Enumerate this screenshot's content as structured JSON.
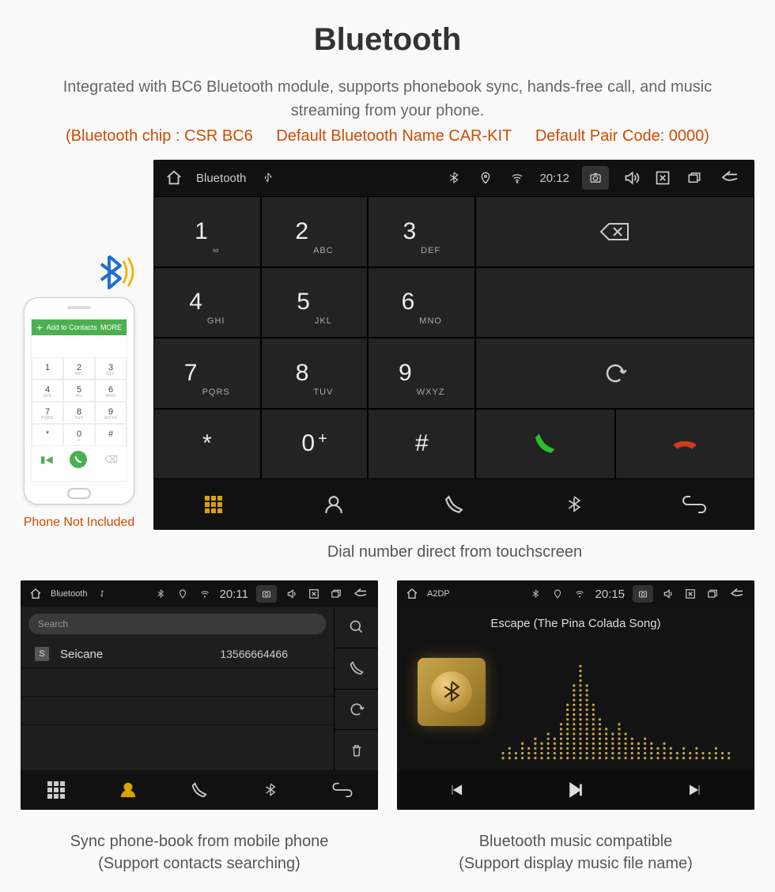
{
  "title": "Bluetooth",
  "description": "Integrated with BC6 Bluetooth module, supports phonebook sync, hands-free call, and music streaming from your phone.",
  "spec": {
    "chip": "(Bluetooth chip : CSR BC6",
    "name": "Default Bluetooth Name CAR-KIT",
    "code": "Default Pair Code: 0000)"
  },
  "phone_mock": {
    "bar_label": "Add to Contacts",
    "bar_more": "MORE",
    "keys": [
      {
        "n": "1",
        "s": ""
      },
      {
        "n": "2",
        "s": "ABC"
      },
      {
        "n": "3",
        "s": "DEF"
      },
      {
        "n": "4",
        "s": "GHI"
      },
      {
        "n": "5",
        "s": "JKL"
      },
      {
        "n": "6",
        "s": "MNO"
      },
      {
        "n": "7",
        "s": "PQRS"
      },
      {
        "n": "8",
        "s": "TUV"
      },
      {
        "n": "9",
        "s": "WXYZ"
      },
      {
        "n": "*",
        "s": ""
      },
      {
        "n": "0",
        "s": "+"
      },
      {
        "n": "#",
        "s": ""
      }
    ],
    "note": "Phone Not Included"
  },
  "dialer": {
    "status_title": "Bluetooth",
    "time": "20:12",
    "keys": [
      {
        "n": "1",
        "s": "∞"
      },
      {
        "n": "2",
        "s": "ABC"
      },
      {
        "n": "3",
        "s": "DEF"
      },
      {
        "n": "4",
        "s": "GHI"
      },
      {
        "n": "5",
        "s": "JKL"
      },
      {
        "n": "6",
        "s": "MNO"
      },
      {
        "n": "7",
        "s": "PQRS"
      },
      {
        "n": "8",
        "s": "TUV"
      },
      {
        "n": "9",
        "s": "WXYZ"
      },
      {
        "n": "*",
        "s": ""
      },
      {
        "n": "0",
        "s": "+",
        "plus": true
      },
      {
        "n": "#",
        "s": ""
      }
    ],
    "caption": "Dial number direct from touchscreen"
  },
  "phonebook": {
    "status_title": "Bluetooth",
    "time": "20:11",
    "search_placeholder": "Search",
    "contact_badge": "S",
    "contact_name": "Seicane",
    "contact_number": "13566664466",
    "caption_l1": "Sync phone-book from mobile phone",
    "caption_l2": "(Support contacts searching)"
  },
  "music": {
    "status_title": "A2DP",
    "time": "20:15",
    "track": "Escape (The Pina Colada Song)",
    "caption_l1": "Bluetooth music compatible",
    "caption_l2": "(Support display music file name)"
  }
}
